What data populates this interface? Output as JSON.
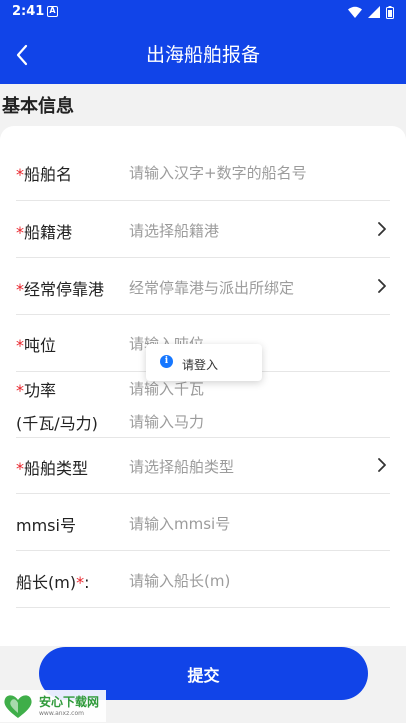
{
  "status_bar": {
    "time": "2:41",
    "notification_glyph": "A"
  },
  "header": {
    "title": "出海船舶报备",
    "back_icon": "chevron-left-icon"
  },
  "section": {
    "title": "基本信息"
  },
  "form": {
    "required_mark": "*",
    "fields": [
      {
        "label": "船舶名",
        "required": true,
        "placeholder": "请输入汉字+数字的船名号",
        "has_arrow": false
      },
      {
        "label": "船籍港",
        "required": true,
        "placeholder": "请选择船籍港",
        "has_arrow": true
      },
      {
        "label": "经常停靠港",
        "required": true,
        "placeholder": "经常停靠港与派出所绑定",
        "has_arrow": true
      },
      {
        "label": "吨位",
        "required": true,
        "placeholder": "请输入吨位",
        "has_arrow": false
      },
      {
        "label": "功率",
        "label_line2": "(千瓦/马力)",
        "required": true,
        "placeholder": "请输入千瓦",
        "placeholder2": "请输入马力",
        "has_arrow": false
      },
      {
        "label": "船舶类型",
        "required": true,
        "placeholder": "请选择船舶类型",
        "has_arrow": true
      },
      {
        "label": "mmsi号",
        "required": false,
        "placeholder": "请输入mmsi号",
        "has_arrow": false
      },
      {
        "label": "船长(m)",
        "label_suffix": ":",
        "required_after": true,
        "placeholder": "请输入船长(m)",
        "has_arrow": false
      }
    ]
  },
  "toast": {
    "text": "请登入",
    "icon": "info-icon"
  },
  "submit": {
    "label": "提交"
  },
  "watermark": {
    "brand": "安心下载网",
    "url": "www.anxz.com"
  },
  "colors": {
    "primary": "#1144e8",
    "required": "#e8232a",
    "placeholder": "#9c9c9c"
  }
}
